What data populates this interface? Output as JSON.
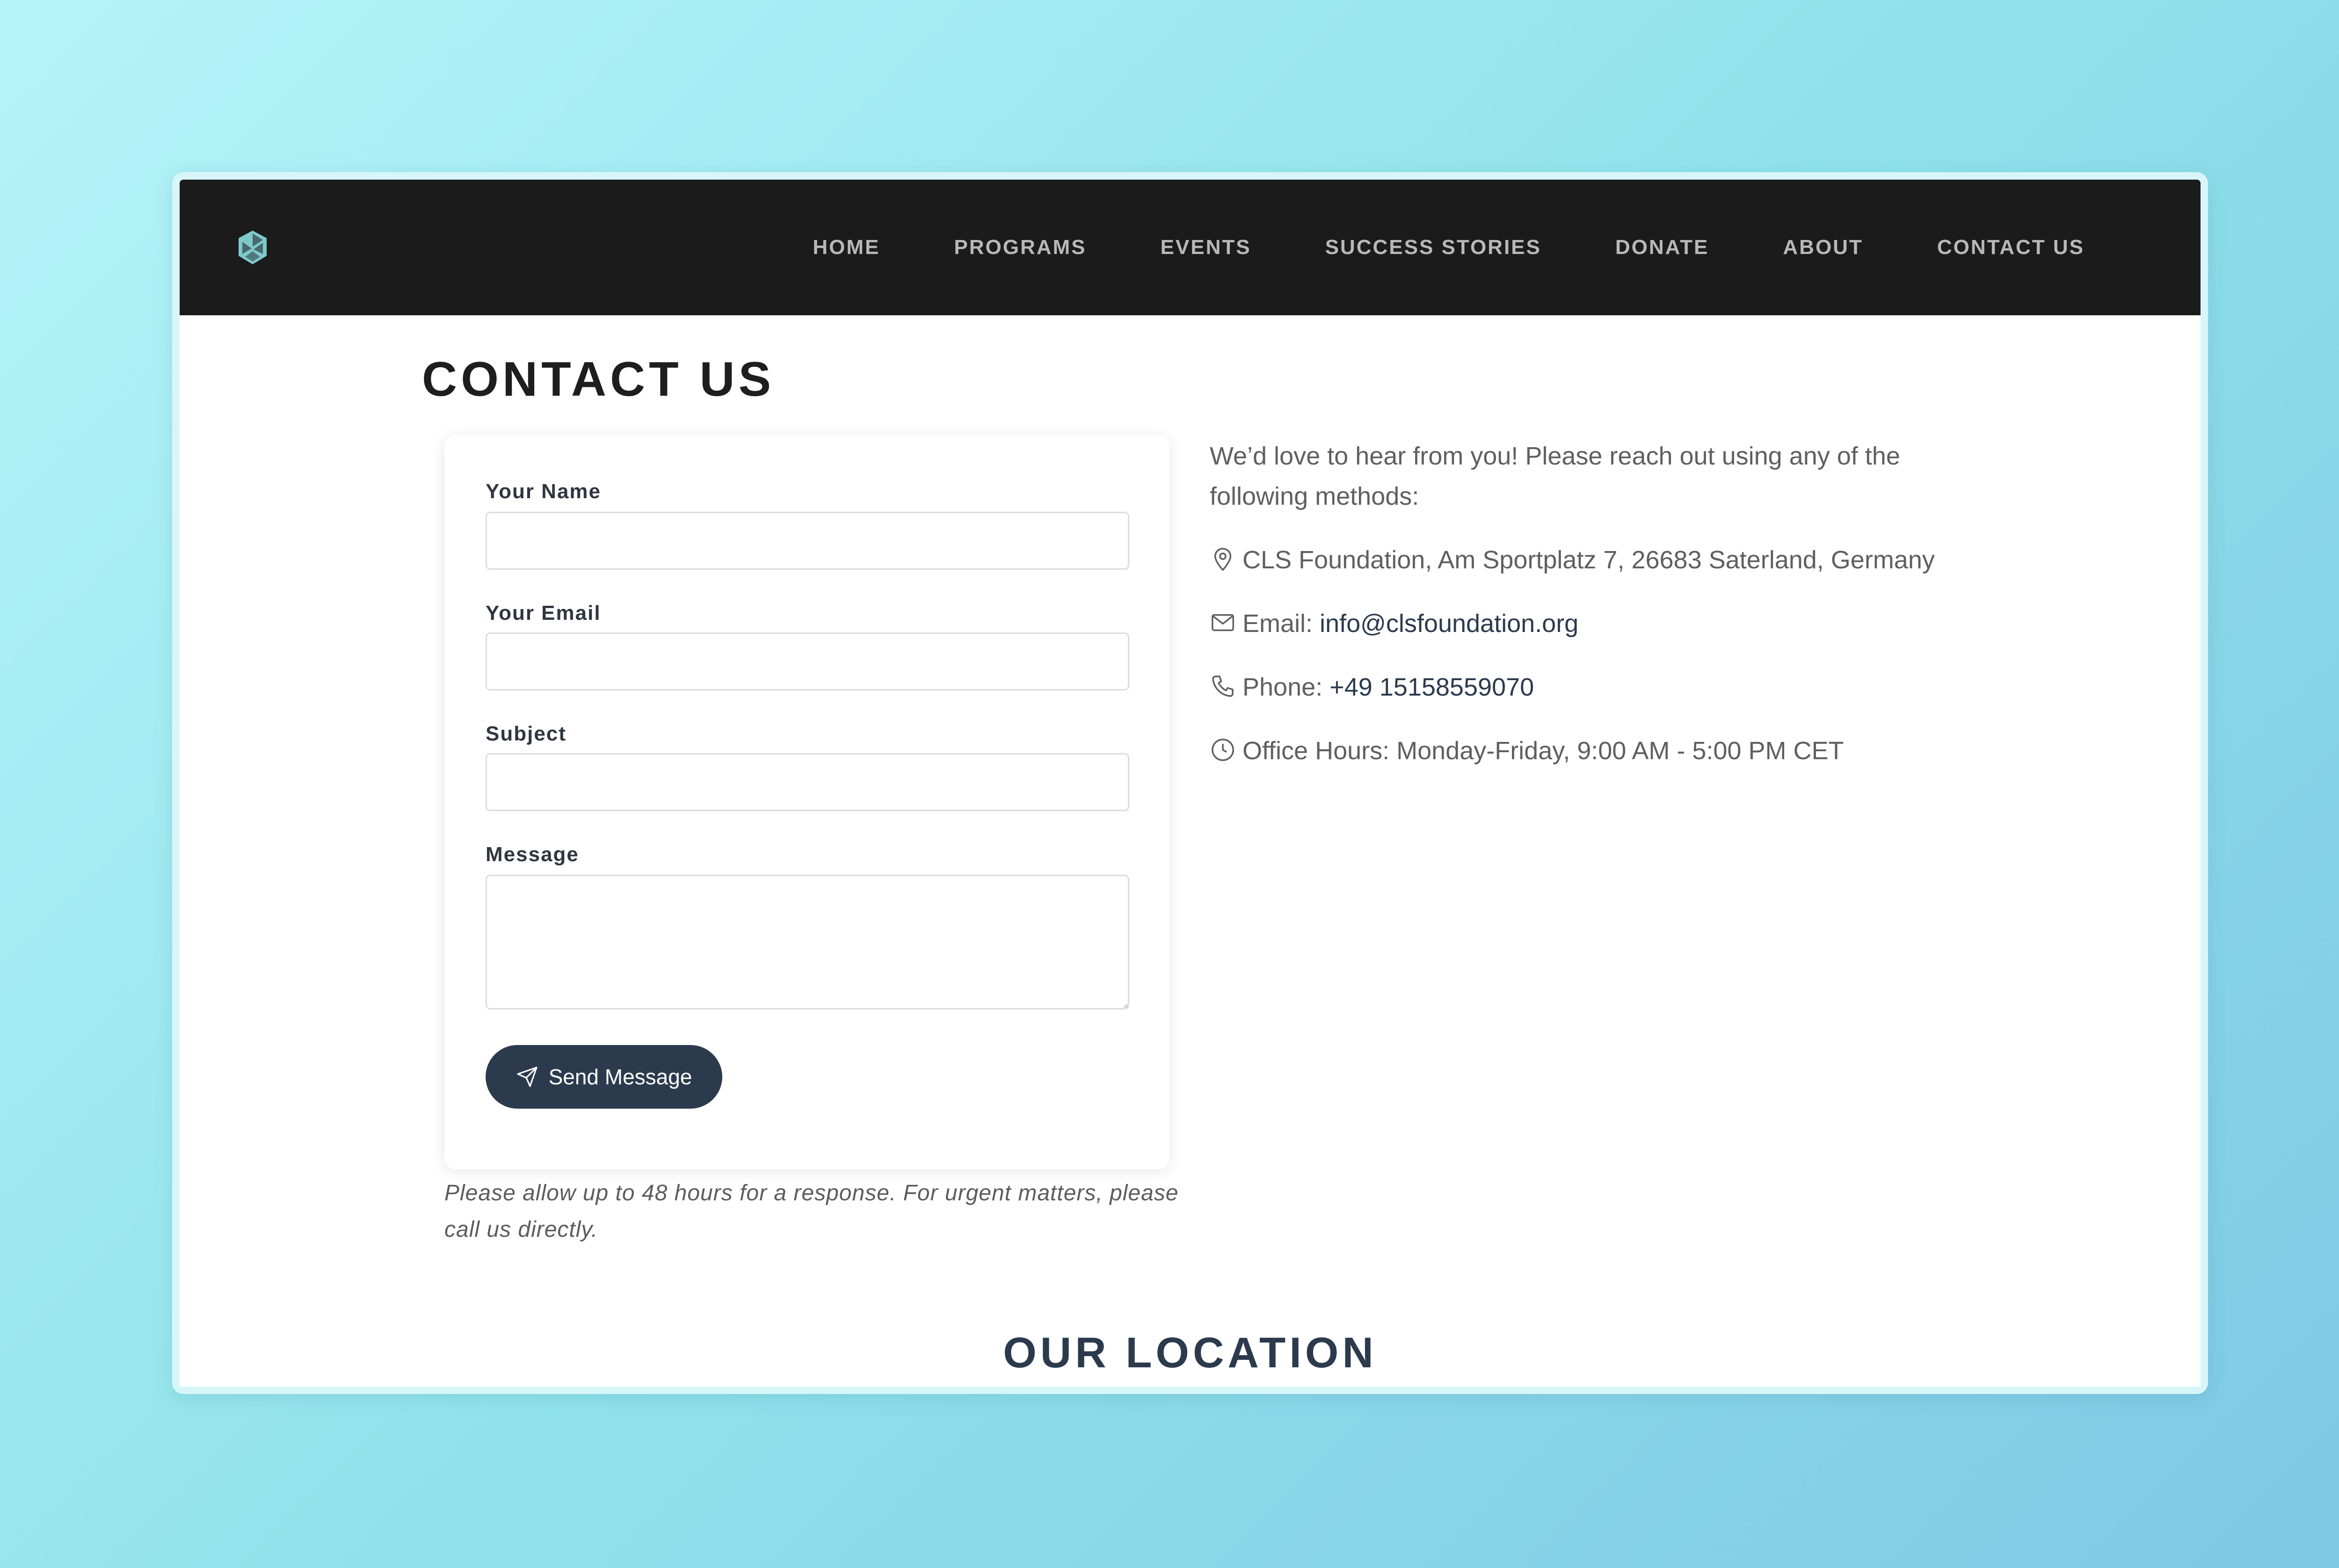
{
  "nav": {
    "logo": "clover-logo-icon",
    "items": [
      {
        "label": "HOME"
      },
      {
        "label": "PROGRAMS"
      },
      {
        "label": "EVENTS"
      },
      {
        "label": "SUCCESS STORIES"
      },
      {
        "label": "DONATE"
      },
      {
        "label": "ABOUT"
      },
      {
        "label": "CONTACT US"
      }
    ]
  },
  "page": {
    "title": "CONTACT US"
  },
  "form": {
    "name_label": "Your Name",
    "name_value": "",
    "email_label": "Your Email",
    "email_value": "",
    "subject_label": "Subject",
    "subject_value": "",
    "message_label": "Message",
    "message_value": "",
    "send_label": "Send Message",
    "send_icon": "send-icon"
  },
  "note": "Please allow up to 48 hours for a response. For urgent matters, please call us directly.",
  "contact": {
    "intro": "We’d love to hear from you! Please reach out using any of the following methods:",
    "address": "CLS Foundation, Am Sportplatz 7, 26683 Saterland, Germany",
    "email_prefix": "Email: ",
    "email": "info@clsfoundation.org",
    "phone_prefix": "Phone: ",
    "phone": "+49 15158559070",
    "hours": "Office Hours: Monday-Friday, 9:00 AM - 5:00 PM CET",
    "icons": [
      "map-pin-icon",
      "envelope-icon",
      "phone-icon",
      "clock-icon"
    ]
  },
  "location_title": "OUR LOCATION",
  "colors": {
    "navbar": "#1b1b1b",
    "primary": "#2c3a4d",
    "logo": "#7fc8cc"
  }
}
